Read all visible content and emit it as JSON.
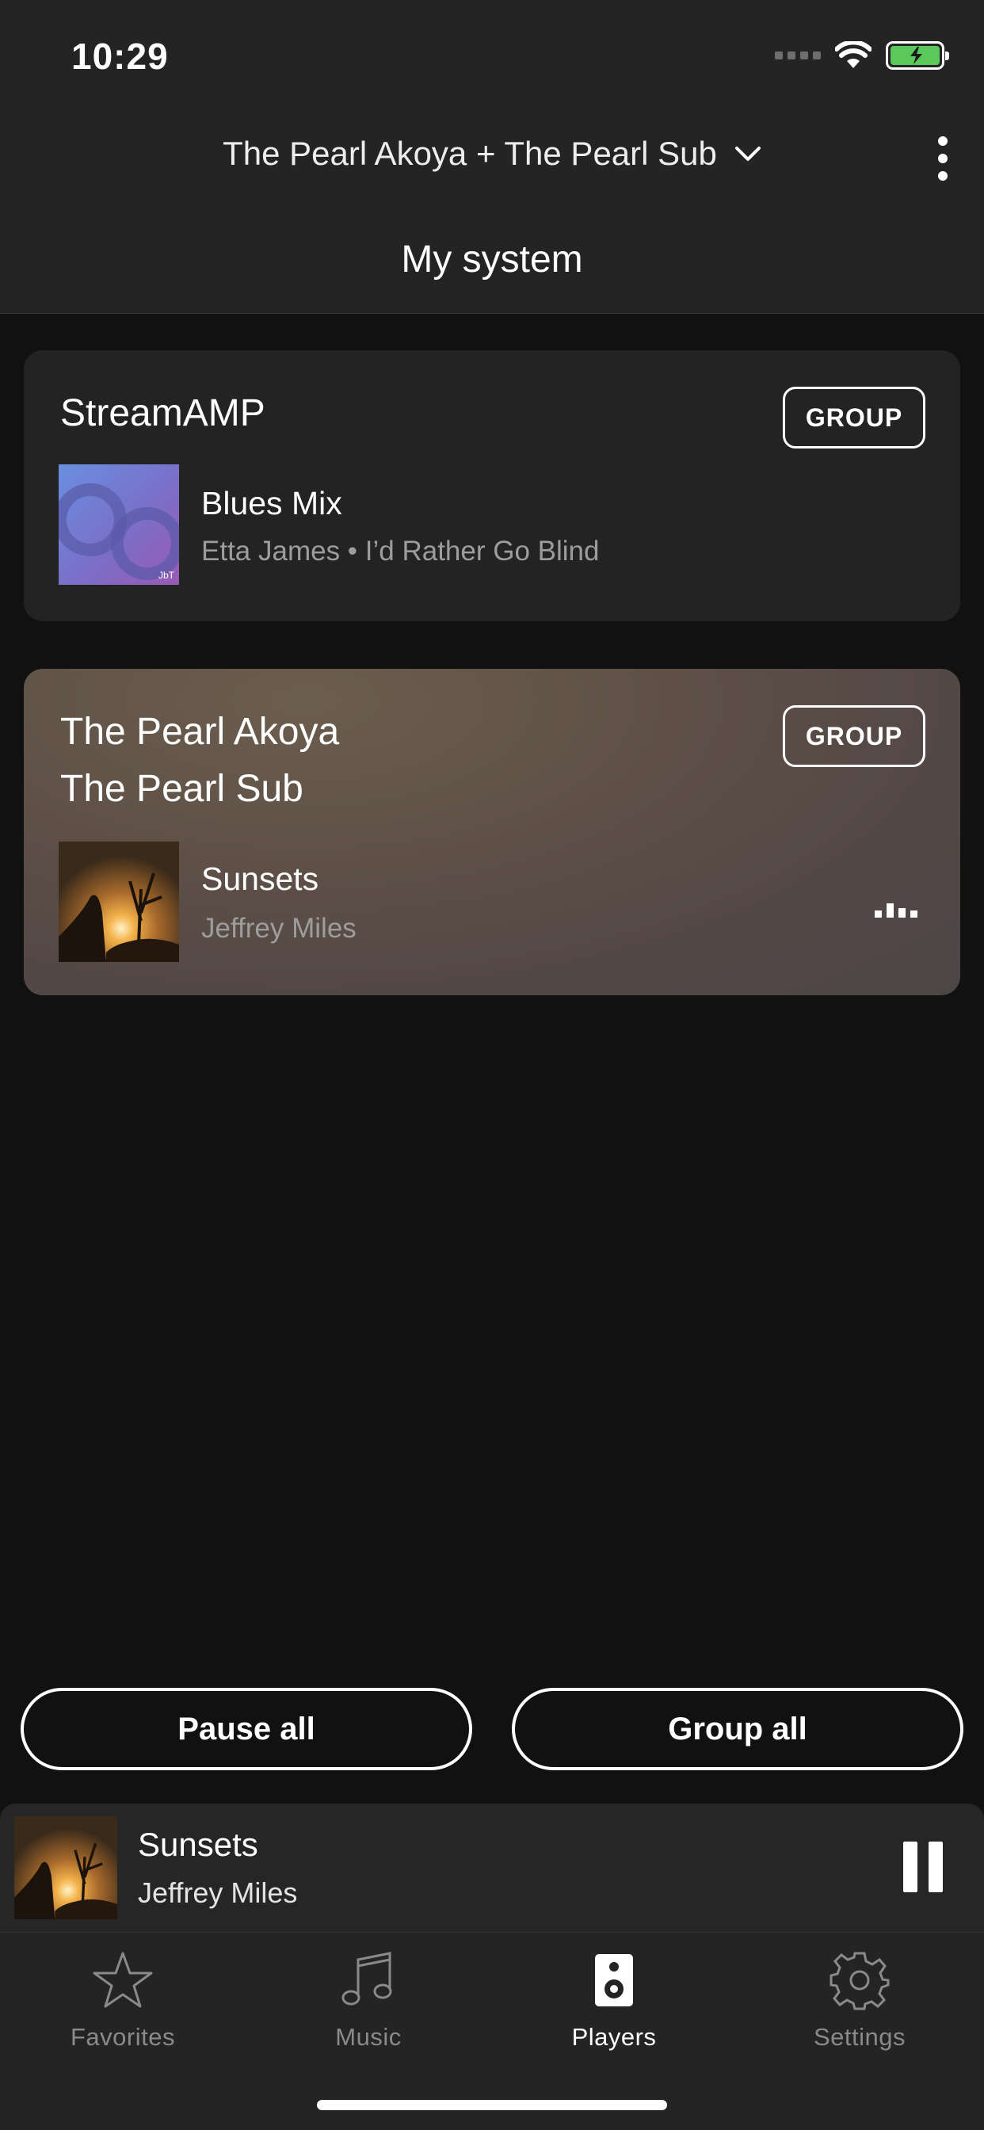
{
  "status_bar": {
    "time": "10:29"
  },
  "header": {
    "system_name": "The Pearl Akoya + The Pearl Sub",
    "title": "My system"
  },
  "players": [
    {
      "name_lines": [
        "StreamAMP"
      ],
      "group_label": "GROUP",
      "track_title": "Blues Mix",
      "track_subtitle": "Etta James • I’d Rather Go Blind",
      "art": "blues-mix-art"
    },
    {
      "name_lines": [
        "The Pearl Akoya",
        "The Pearl Sub"
      ],
      "group_label": "GROUP",
      "track_title": "Sunsets",
      "track_subtitle": "Jeffrey Miles",
      "art": "sunsets-art",
      "playing": true
    }
  ],
  "actions": {
    "pause_all": "Pause all",
    "group_all": "Group all"
  },
  "now_playing": {
    "title": "Sunsets",
    "artist": "Jeffrey Miles"
  },
  "tabs": [
    {
      "label": "Favorites",
      "icon": "star-icon",
      "active": false
    },
    {
      "label": "Music",
      "icon": "music-note-icon",
      "active": false
    },
    {
      "label": "Players",
      "icon": "speaker-icon",
      "active": true
    },
    {
      "label": "Settings",
      "icon": "gear-icon",
      "active": false
    }
  ],
  "colors": {
    "background": "#111111",
    "header": "#242424",
    "card": "#232323",
    "battery": "#5ac85a"
  }
}
